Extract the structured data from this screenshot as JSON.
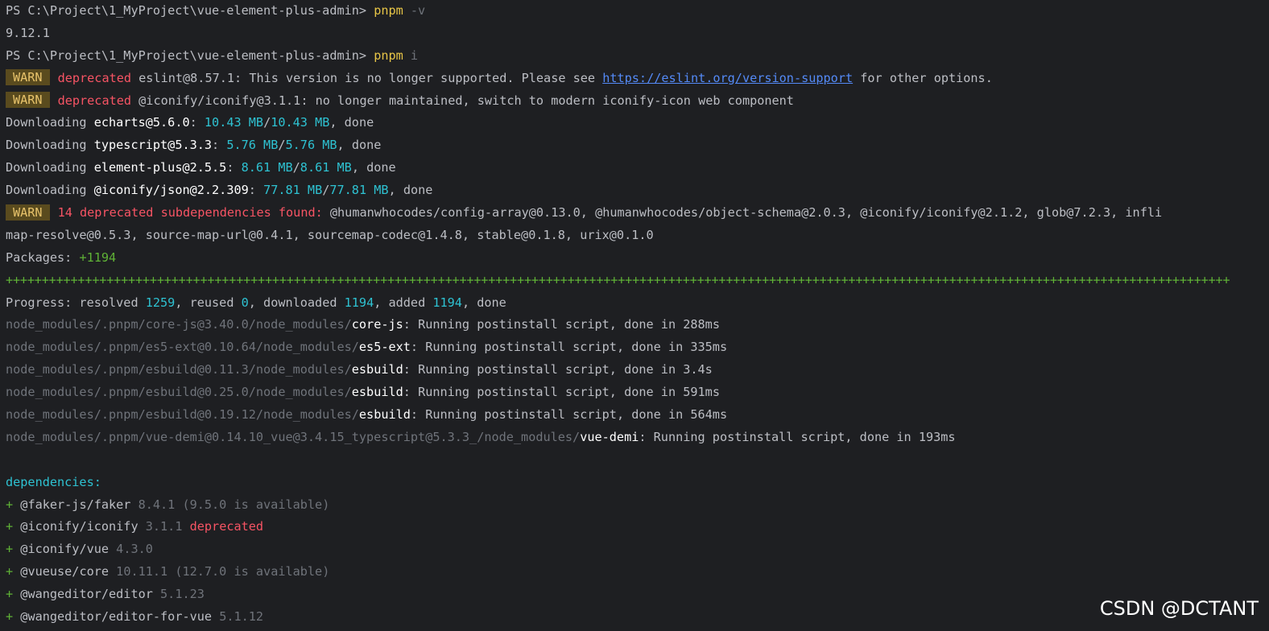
{
  "lines": {
    "l1": {
      "prompt": "PS C:\\Project\\1_MyProject\\vue-element-plus-admin> ",
      "cmd": "pnpm",
      "arg": " -v"
    },
    "l2": {
      "text": "9.12.1"
    },
    "l3": {
      "prompt": "PS C:\\Project\\1_MyProject\\vue-element-plus-admin> ",
      "cmd": "pnpm",
      "arg": " i"
    },
    "l4": {
      "badge": "WARN",
      "tag": "deprecated",
      "pkg": " eslint@8.57.1: This version is no longer supported. Please see ",
      "link": "https://eslint.org/version-support",
      "rest": " for other options."
    },
    "l5": {
      "badge": "WARN",
      "tag": "deprecated",
      "text": " @iconify/iconify@3.1.1: no longer maintained, switch to modern iconify-icon web component"
    },
    "l6": {
      "pre": "Downloading ",
      "pkg": "echarts@5.6.0",
      "colon": ": ",
      "a": "10.43 MB",
      "slash": "/",
      "b": "10.43 MB",
      "done": ", done"
    },
    "l7": {
      "pre": "Downloading ",
      "pkg": "typescript@5.3.3",
      "colon": ": ",
      "a": "5.76 MB",
      "slash": "/",
      "b": "5.76 MB",
      "done": ", done"
    },
    "l8": {
      "pre": "Downloading ",
      "pkg": "element-plus@2.5.5",
      "colon": ": ",
      "a": "8.61 MB",
      "slash": "/",
      "b": "8.61 MB",
      "done": ", done"
    },
    "l9": {
      "pre": "Downloading ",
      "pkg": "@iconify/json@2.2.309",
      "colon": ": ",
      "a": "77.81 MB",
      "slash": "/",
      "b": "77.81 MB",
      "done": ", done"
    },
    "l10": {
      "badge": "WARN",
      "tag": "14 deprecated subdependencies found:",
      "text": " @humanwhocodes/config-array@0.13.0, @humanwhocodes/object-schema@2.0.3, @iconify/iconify@2.1.2, glob@7.2.3, infli"
    },
    "l11": {
      "text": "map-resolve@0.5.3, source-map-url@0.4.1, sourcemap-codec@1.4.8, stable@0.1.8, urix@0.1.0"
    },
    "l12": {
      "label": "Packages: ",
      "value": "+1194"
    },
    "l13": {
      "bar": "++++++++++++++++++++++++++++++++++++++++++++++++++++++++++++++++++++++++++++++++++++++++++++++++++++++++++++++++++++++++++++++++++++++++++++++++++++++++++++++++++++++++++"
    },
    "l14": {
      "p1": "Progress: resolved ",
      "resolved": "1259",
      "p2": ", reused ",
      "reused": "0",
      "p3": ", downloaded ",
      "downloaded": "1194",
      "p4": ", added ",
      "added": "1194",
      "p5": ", done"
    },
    "l15": {
      "path": "node_modules/.pnpm/core-js@3.40.0/node_modules/",
      "pkg": "core-js",
      "rest": ": Running postinstall script, done in 288ms"
    },
    "l16": {
      "path": "node_modules/.pnpm/es5-ext@0.10.64/node_modules/",
      "pkg": "es5-ext",
      "rest": ": Running postinstall script, done in 335ms"
    },
    "l17": {
      "path": "node_modules/.pnpm/esbuild@0.11.3/node_modules/",
      "pkg": "esbuild",
      "rest": ": Running postinstall script, done in 3.4s"
    },
    "l18": {
      "path": "node_modules/.pnpm/esbuild@0.25.0/node_modules/",
      "pkg": "esbuild",
      "rest": ": Running postinstall script, done in 591ms"
    },
    "l19": {
      "path": "node_modules/.pnpm/esbuild@0.19.12/node_modules/",
      "pkg": "esbuild",
      "rest": ": Running postinstall script, done in 564ms"
    },
    "l20": {
      "path": "node_modules/.pnpm/vue-demi@0.14.10_vue@3.4.15_typescript@5.3.3_/node_modules/",
      "pkg": "vue-demi",
      "rest": ": Running postinstall script, done in 193ms"
    },
    "l22": {
      "text": "dependencies:"
    },
    "l23": {
      "plus": "+ ",
      "pkg": "@faker-js/faker",
      "ver": " 8.4.1 (9.5.0 is available)"
    },
    "l24": {
      "plus": "+ ",
      "pkg": "@iconify/iconify",
      "ver": " 3.1.1 ",
      "tag": "deprecated"
    },
    "l25": {
      "plus": "+ ",
      "pkg": "@iconify/vue",
      "ver": " 4.3.0"
    },
    "l26": {
      "plus": "+ ",
      "pkg": "@vueuse/core",
      "ver": " 10.11.1 (12.7.0 is available)"
    },
    "l27": {
      "plus": "+ ",
      "pkg": "@wangeditor/editor",
      "ver": " 5.1.23"
    },
    "l28": {
      "plus": "+ ",
      "pkg": "@wangeditor/editor-for-vue",
      "ver": " 5.1.12"
    }
  },
  "watermark": "CSDN @DCTANT",
  "colors": {
    "background": "#1e1f22",
    "default_text": "#bcbec4",
    "command": "#e7c547",
    "warn_badge_bg": "#5a4b1e",
    "deprecated": "#f75464",
    "size": "#2ec2d2",
    "green": "#5fb236",
    "link": "#548af7",
    "dim_path": "#6f737a"
  }
}
